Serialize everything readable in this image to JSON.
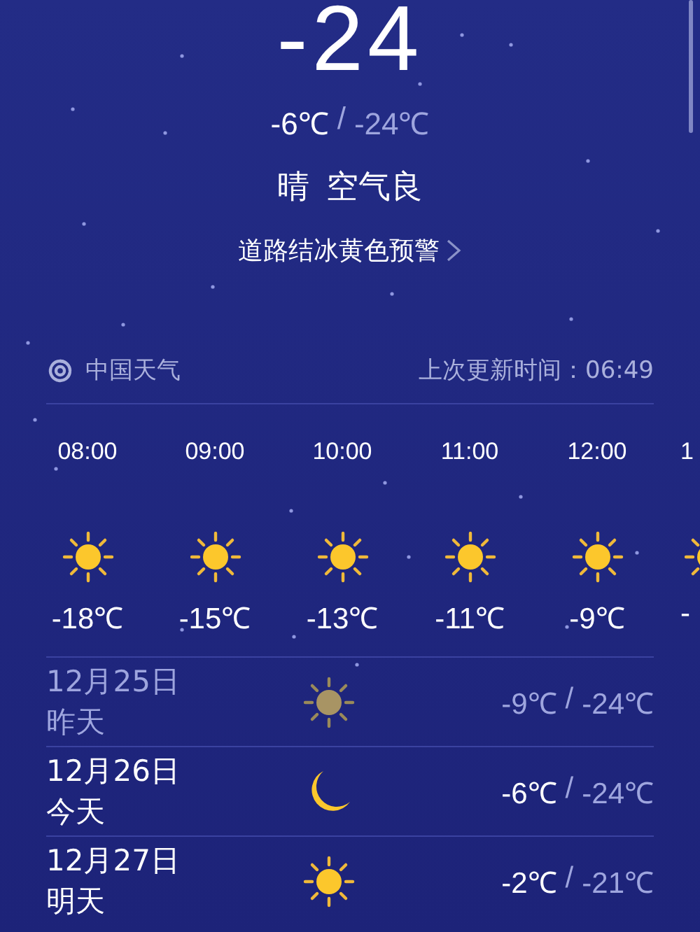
{
  "current": {
    "temperature": "-24",
    "high": "-6℃",
    "separator": "/",
    "low": "-24℃",
    "condition": "晴",
    "air_quality": "空气良",
    "alert": "道路结冰黄色预警"
  },
  "source": {
    "name": "中国天气",
    "updated": "上次更新时间：06:49"
  },
  "hourly": [
    {
      "time": "08:00",
      "kind": "sun",
      "temp": "-18℃"
    },
    {
      "time": "09:00",
      "kind": "sun",
      "temp": "-15℃"
    },
    {
      "time": "10:00",
      "kind": "sun",
      "temp": "-13℃"
    },
    {
      "time": "11:00",
      "kind": "sun",
      "temp": "-11℃"
    },
    {
      "time": "12:00",
      "kind": "sun",
      "temp": "-9℃"
    },
    {
      "time": "1",
      "kind": "sun",
      "temp": "-"
    }
  ],
  "daily": [
    {
      "date": "12月25日",
      "day": "昨天",
      "kind": "sun",
      "past": true,
      "high": "-9℃",
      "separator": "/",
      "low": "-24℃"
    },
    {
      "date": "12月26日",
      "day": "今天",
      "kind": "moon",
      "past": false,
      "high": "-6℃",
      "separator": "/",
      "low": "-24℃"
    },
    {
      "date": "12月27日",
      "day": "明天",
      "kind": "sun",
      "past": false,
      "high": "-2℃",
      "separator": "/",
      "low": "-21℃"
    }
  ]
}
